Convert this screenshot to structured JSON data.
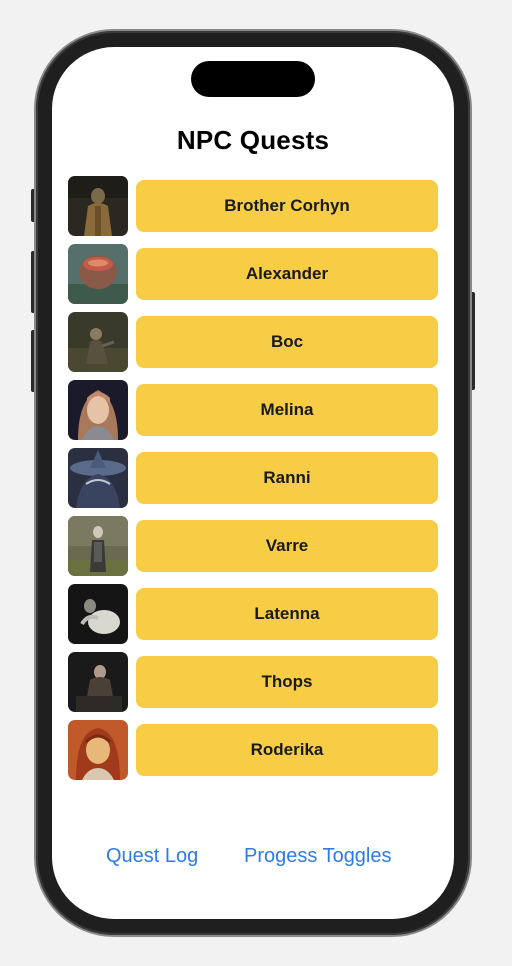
{
  "screen": {
    "title": "NPC Quests"
  },
  "npcs": [
    {
      "name": "Brother Corhyn",
      "icon": "brother-corhyn-portrait"
    },
    {
      "name": "Alexander",
      "icon": "alexander-portrait"
    },
    {
      "name": "Boc",
      "icon": "boc-portrait"
    },
    {
      "name": "Melina",
      "icon": "melina-portrait"
    },
    {
      "name": "Ranni",
      "icon": "ranni-portrait"
    },
    {
      "name": "Varre",
      "icon": "varre-portrait"
    },
    {
      "name": "Latenna",
      "icon": "latenna-portrait"
    },
    {
      "name": "Thops",
      "icon": "thops-portrait"
    },
    {
      "name": "Roderika",
      "icon": "roderika-portrait"
    }
  ],
  "bottom_nav": {
    "quest_log": "Quest Log",
    "progress_toggles": "Progess Toggles"
  },
  "colors": {
    "button_background": "#f7cd45",
    "link": "#2f7be6",
    "background": "#f2f2f2"
  }
}
